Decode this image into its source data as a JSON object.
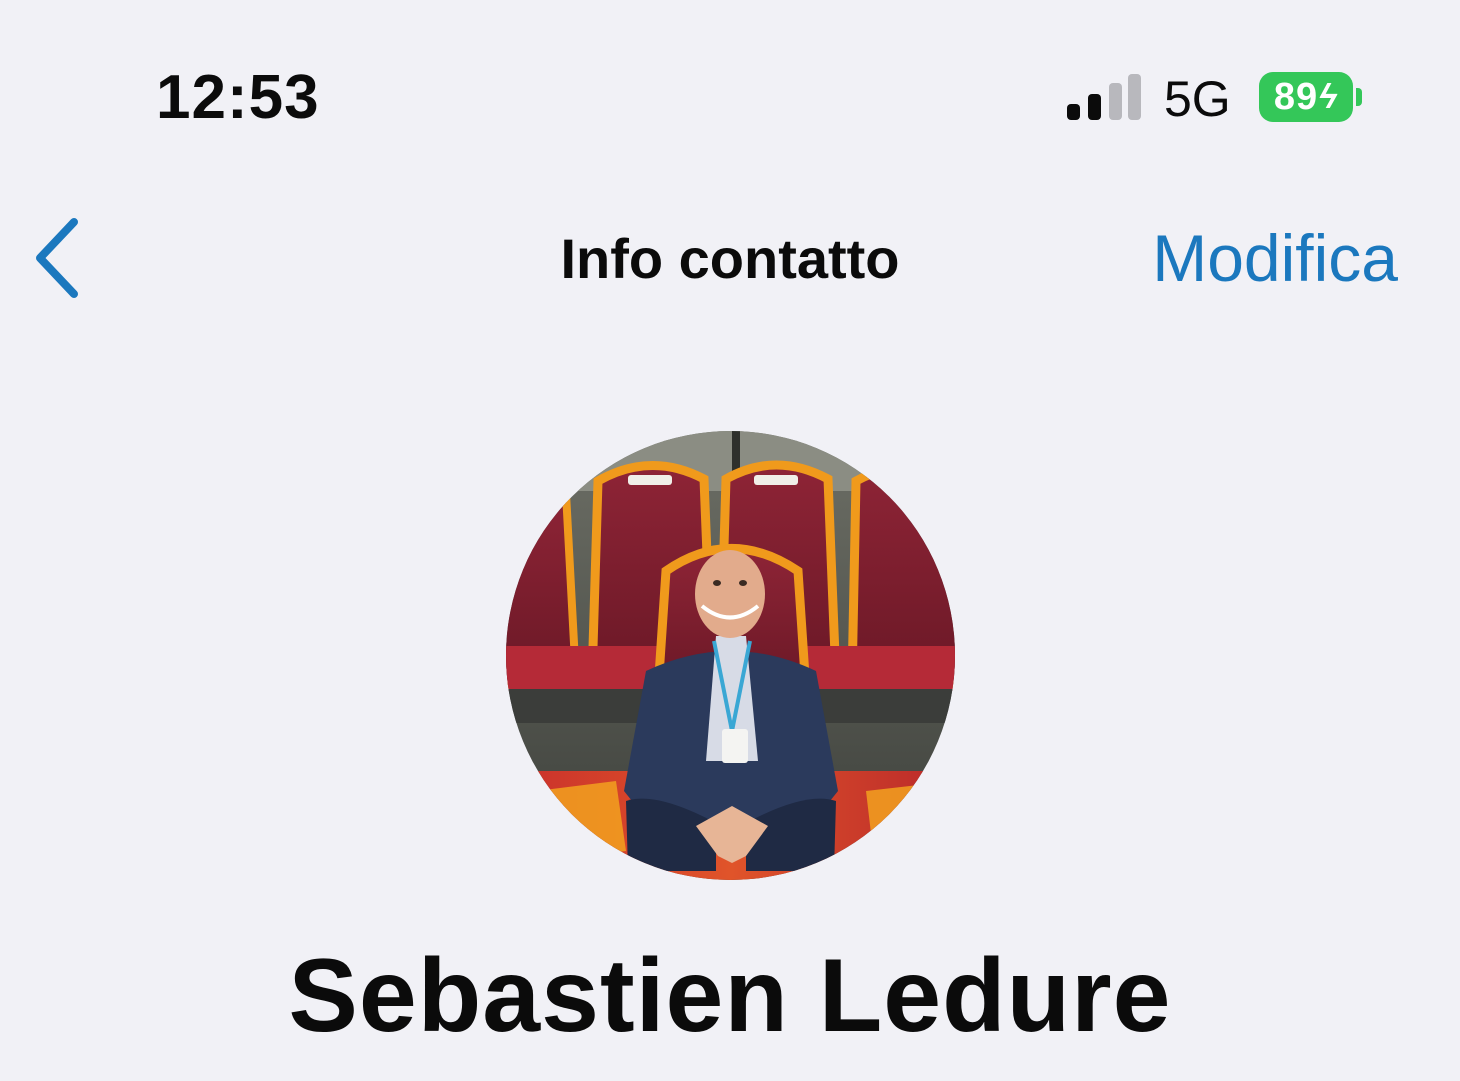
{
  "status_bar": {
    "time": "12:53",
    "network": "5G",
    "battery_percent": "89",
    "battery_charging_glyph": "ϟ",
    "signal_bars_active": 2,
    "signal_bars_total": 4,
    "battery_color": "#34c759",
    "signal_inactive_color": "#b8b8bd"
  },
  "nav": {
    "back_icon": "chevron-left-icon",
    "title": "Info contatto",
    "edit_label": "Modifica",
    "accent_color": "#1b78be"
  },
  "contact": {
    "name": "Sebastien Ledure",
    "avatar": "profile-photo"
  }
}
